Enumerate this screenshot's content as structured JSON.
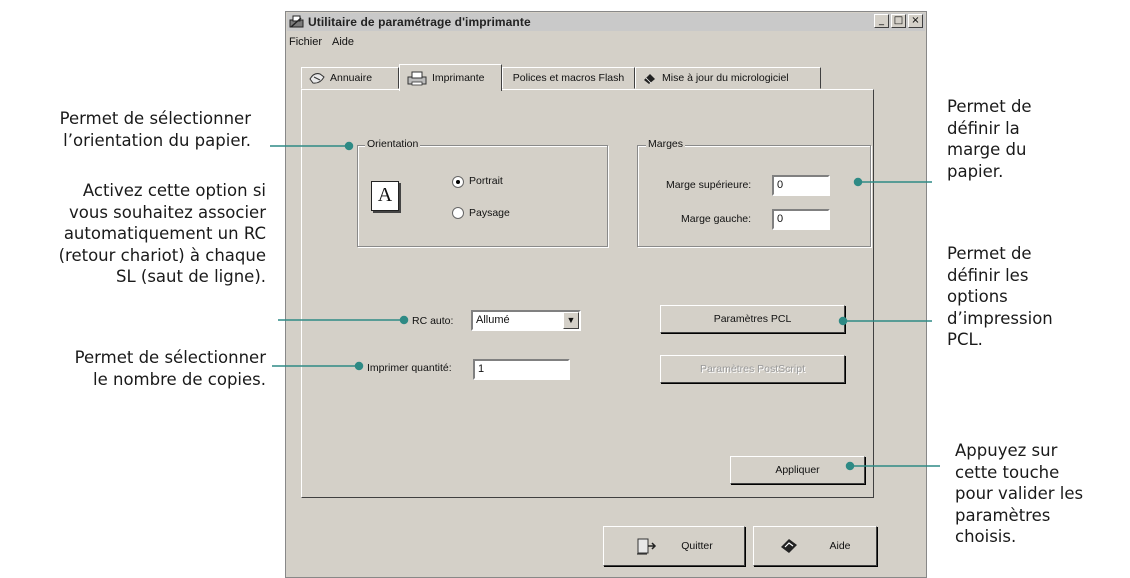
{
  "window": {
    "title": "Utilitaire de paramétrage d'imprimante",
    "minimize": "_",
    "maximize": "□",
    "close": "×"
  },
  "menu": {
    "file": "Fichier",
    "help": "Aide"
  },
  "tabs": [
    {
      "label": "Annuaire",
      "icon": "address-book-icon"
    },
    {
      "label": "Imprimante",
      "icon": "printer-icon",
      "active": true
    },
    {
      "label": "Polices et macros Flash"
    },
    {
      "label": "Mise à jour du micrologiciel",
      "icon": "firmware-chip-icon"
    }
  ],
  "orientation": {
    "legend": "Orientation",
    "portrait": "Portrait",
    "landscape": "Paysage",
    "selected": "Portrait",
    "icon_glyph": "A"
  },
  "margins": {
    "legend": "Marges",
    "top_label": "Marge supérieure:",
    "top_value": "0",
    "left_label": "Marge gauche:",
    "left_value": "0"
  },
  "rc_auto": {
    "label": "RC auto:",
    "value": "Allumé"
  },
  "quantity": {
    "label": "Imprimer quantité:",
    "value": "1"
  },
  "buttons": {
    "pcl": "Paramètres PCL",
    "postscript": "Paramètres PostScript",
    "apply": "Appliquer",
    "quit": "Quitter",
    "help": "Aide"
  },
  "annotations": {
    "orientation": [
      "Permet de sélectionner",
      "l’orientation du papier."
    ],
    "rc_auto": [
      "Activez cette option si",
      "vous souhaitez associer",
      "automatiquement un RC",
      "(retour chariot) à chaque",
      "SL (saut de ligne)."
    ],
    "quantity": [
      "Permet de sélectionner",
      "le nombre de copies."
    ],
    "margins": [
      "Permet de",
      "définir la",
      "marge du",
      "papier."
    ],
    "pcl": [
      "Permet de",
      "définir les",
      "options",
      "d’impression",
      "PCL."
    ],
    "apply": [
      "Appuyez sur",
      "cette touche",
      "pour valider les",
      "paramètres",
      "choisis."
    ]
  },
  "colors": {
    "callout_line": "#2e8a85",
    "window_face": "#d4d0c8"
  }
}
